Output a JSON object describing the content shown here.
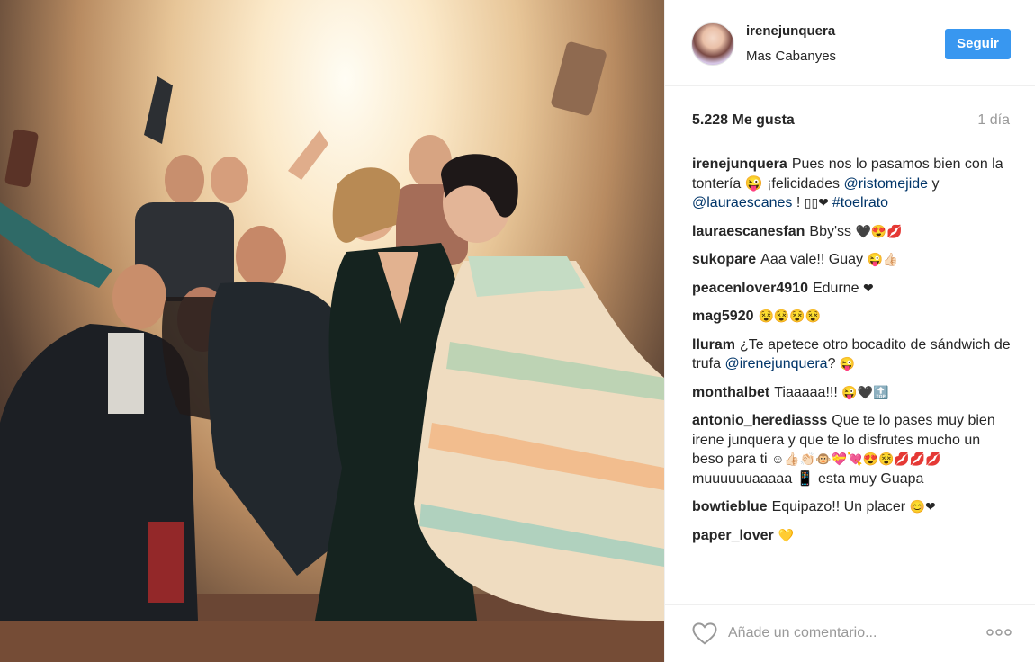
{
  "post": {
    "username": "irenejunquera",
    "location": "Mas Cabanyes",
    "follow_label": "Seguir",
    "likes": "5.228 Me gusta",
    "time": "1 día"
  },
  "caption": {
    "user": "irenejunquera",
    "text_a": "Pues nos lo pasamos bien con la tontería 😜 ¡felicidades ",
    "mention_1": "@ristomejide",
    "text_b": " y ",
    "mention_2": "@lauraescanes",
    "text_c": " ! ",
    "emoji": "▯▯❤ ",
    "hashtag": "#toelrato"
  },
  "comments": [
    {
      "user": "lauraescanesfan",
      "text": "Bby'ss ",
      "emoji": "🖤😍💋"
    },
    {
      "user": "sukopare",
      "text": "Aaa vale!! Guay ",
      "emoji": "😜👍🏻"
    },
    {
      "user": "peacenlover4910",
      "text": "Edurne ",
      "emoji": "❤"
    },
    {
      "user": "mag5920",
      "text": "",
      "emoji": "😵😵😵😵"
    },
    {
      "user": "lluram",
      "text": "¿Te apetece otro bocadito de sándwich de trufa ",
      "mention": "@irenejunquera",
      "text_after": "? ",
      "emoji": "😜"
    },
    {
      "user": "monthalbet",
      "text": "Tiaaaaa!!! ",
      "emoji": "😜🖤🔝"
    },
    {
      "user": "antonio_herediasss",
      "text": "Que te lo pases muy bien irene junquera y que te lo disfrutes mucho un beso para ti ",
      "emoji": "☺👍🏻👏🏻🐵💝💘😍😵💋💋💋",
      "text_after": "muuuuuuaaaaa 📱 esta muy Guapa"
    },
    {
      "user": "bowtieblue",
      "text": "Equipazo!! Un placer ",
      "emoji": "😊❤"
    },
    {
      "user": "paper_lover",
      "text": "",
      "emoji": "💛"
    }
  ],
  "add_comment": {
    "placeholder": "Añade un comentario..."
  },
  "icons": {
    "like": "heart-icon",
    "more": "more-options-icon"
  },
  "colors": {
    "follow_button": "#3897f0",
    "mention": "#003569"
  }
}
